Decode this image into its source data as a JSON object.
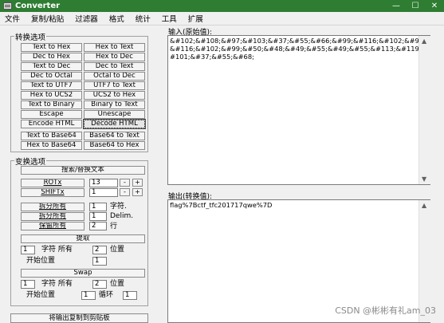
{
  "window": {
    "title": "Converter",
    "minimize": "—",
    "maximize": "☐",
    "close": "✕"
  },
  "menu": [
    "文件",
    "复制/粘贴",
    "过滤器",
    "格式",
    "统计",
    "工具",
    "扩展"
  ],
  "convert": {
    "title": "转换选项",
    "buttons": [
      [
        "Text to Hex",
        "Hex to Text"
      ],
      [
        "Dec to Hex",
        "Hex to Dec"
      ],
      [
        "Text to Dec",
        "Dec to Text"
      ],
      [
        "Dec to Octal",
        "Octal to Dec"
      ],
      [
        "Text to UTF7",
        "UTF7 to Text"
      ],
      [
        "Hex to UCS2",
        "UCS2 to Hex"
      ],
      [
        "Text to Binary",
        "Binary to Text"
      ],
      [
        "Escape",
        "Unescape"
      ],
      [
        "Encode HTML",
        "Decode HTML"
      ],
      [
        "Text to Base64",
        "Base64 to Text"
      ],
      [
        "Hex to Base64",
        "Base64 to Hex"
      ]
    ]
  },
  "transform": {
    "title": "变换选项",
    "search_replace": "搜索/替换文本",
    "rotx": {
      "label": "ROTx",
      "value": "13",
      "minus": "-",
      "plus": "+"
    },
    "shiftx": {
      "label": "SHIFTx",
      "value": "1",
      "minus": "-",
      "plus": "+"
    },
    "split1": {
      "label": "拆分所有",
      "value": "1",
      "unit": "字符."
    },
    "split2": {
      "label": "拆分所有",
      "value": "1",
      "unit": "Delim."
    },
    "keep": {
      "label": "保留所有",
      "value": "2",
      "unit": "行"
    },
    "extract": {
      "button": "提取",
      "count": "1",
      "chars_label": "字符 所有",
      "positions": "2",
      "pos_label": "位置",
      "start_label": "开始位置",
      "start": "1"
    },
    "swap": {
      "button": "Swap",
      "count": "1",
      "chars_label": "字符 所有",
      "positions": "2",
      "pos_label": "位置",
      "start_label": "开始位置",
      "start": "1",
      "loop_label": "循环",
      "loop": "1"
    },
    "copy_button": "将输出复制到剪贴板"
  },
  "input": {
    "label": "输入(原始值):",
    "value": "&#102;&#108;&#97;&#103;&#37;&#55;&#66;&#99;&#116;&#102;&#95;&#116;&#102;&#99;&#50;&#48;&#49;&#55;&#49;&#55;&#113;&#119;&#101;&#37;&#55;&#68;"
  },
  "output": {
    "label": "输出(转换值):",
    "value": "flag%7Bctf_tfc201717qwe%7D"
  },
  "watermark": "CSDN @彬彬有礼am_03"
}
